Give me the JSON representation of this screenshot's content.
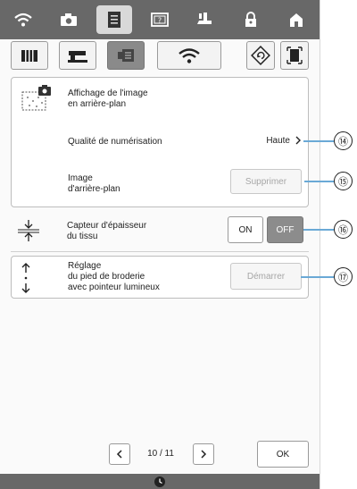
{
  "top_tabs": [
    {
      "icon": "wifi-icon",
      "active": false
    },
    {
      "icon": "camera-icon",
      "active": false
    },
    {
      "icon": "document-icon",
      "active": true
    },
    {
      "icon": "help-icon",
      "active": false
    },
    {
      "icon": "sewing-foot-icon",
      "active": false
    },
    {
      "icon": "lock-icon",
      "active": false
    },
    {
      "icon": "home-icon",
      "active": false
    }
  ],
  "sub_tabs": [
    {
      "icon": "book-icon",
      "active": false
    },
    {
      "icon": "sewing-machine-icon",
      "active": false
    },
    {
      "icon": "embroidery-machine-icon",
      "active": true
    },
    {
      "icon": "wifi-icon",
      "active": false
    },
    {
      "icon": "reset-icon",
      "active": false
    },
    {
      "icon": "screen-fit-icon",
      "active": false
    }
  ],
  "panel1": {
    "title": "Affichage de l'image\nen arrière-plan",
    "scan_quality_label": "Qualité de numérisation",
    "scan_quality_value": "Haute",
    "bg_image_label": "Image\nd'arrière-plan",
    "delete_button": "Supprimer"
  },
  "thickness": {
    "label": "Capteur d'épaisseur\ndu tissu",
    "on_label": "ON",
    "off_label": "OFF",
    "selected": "OFF"
  },
  "foot": {
    "label": "Réglage\ndu pied de broderie\navec pointeur lumineux",
    "start_button": "Démarrer"
  },
  "callouts": [
    "⑭",
    "⑮",
    "⑯",
    "⑰"
  ],
  "pager": {
    "text": "10 / 11",
    "prev": "<",
    "next": ">"
  },
  "ok_label": "OK",
  "colors": {
    "header": "#686868",
    "callout_line": "#6aa9d6"
  }
}
